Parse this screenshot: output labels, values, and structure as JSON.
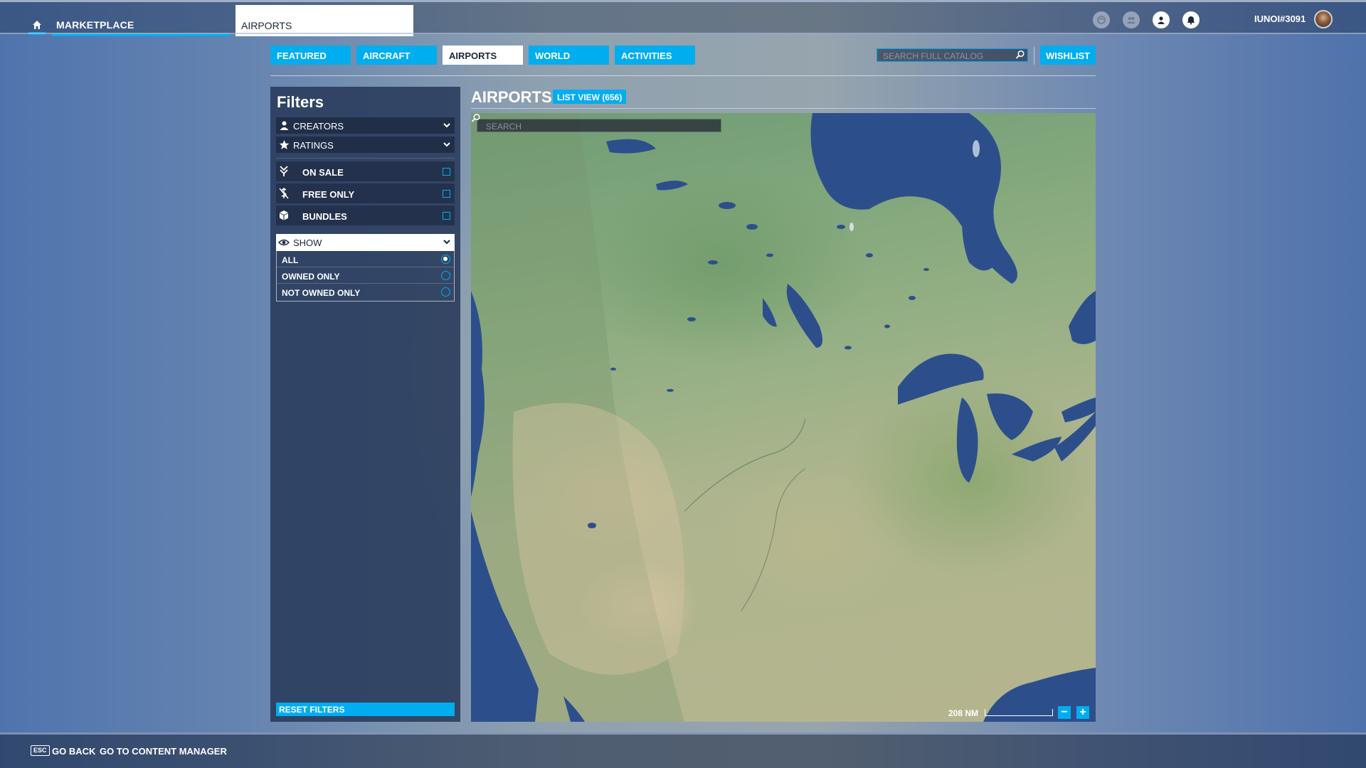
{
  "topbar": {
    "home_icon": "home-icon",
    "marketplace_label": "MARKETPLACE",
    "active_tab_label": "AIRPORTS",
    "status_icons": [
      "events-icon",
      "friends-icon",
      "profile-icon",
      "notifications-icon"
    ],
    "username": "IUNOI#3091"
  },
  "nav": {
    "tabs": [
      {
        "label": "FEATURED",
        "active": false
      },
      {
        "label": "AIRCRAFT",
        "active": false
      },
      {
        "label": "AIRPORTS",
        "active": true
      },
      {
        "label": "WORLD",
        "active": false
      },
      {
        "label": "ACTIVITIES",
        "active": false
      }
    ],
    "search_placeholder": "SEARCH FULL CATALOG",
    "wishlist_label": "WISHLIST"
  },
  "filters": {
    "title": "Filters",
    "dropdowns": [
      {
        "label": "CREATORS",
        "icon": "person-icon"
      },
      {
        "label": "RATINGS",
        "icon": "star-icon"
      }
    ],
    "checkboxes": [
      {
        "label": "ON SALE",
        "icon": "sale-icon",
        "checked": false
      },
      {
        "label": "FREE ONLY",
        "icon": "free-icon",
        "checked": false
      },
      {
        "label": "BUNDLES",
        "icon": "bundle-icon",
        "checked": false
      }
    ],
    "show": {
      "label": "SHOW",
      "icon": "eye-icon",
      "options": [
        {
          "label": "ALL",
          "selected": true
        },
        {
          "label": "OWNED ONLY",
          "selected": false
        },
        {
          "label": "NOT OWNED ONLY",
          "selected": false
        }
      ]
    },
    "reset_label": "RESET FILTERS"
  },
  "main": {
    "title": "AIRPORTS",
    "list_view_label": "LIST VIEW (656)",
    "map": {
      "search_placeholder": "SEARCH",
      "scale_label": "208 NM",
      "zoom_out": "−",
      "zoom_in": "+"
    }
  },
  "footer": {
    "esc_key": "ESC",
    "go_back_label": "GO BACK",
    "content_manager_label": "GO TO CONTENT MANAGER"
  },
  "colors": {
    "accent": "#00adef",
    "panel": "#283a5a",
    "water": "#2c4f8c"
  }
}
